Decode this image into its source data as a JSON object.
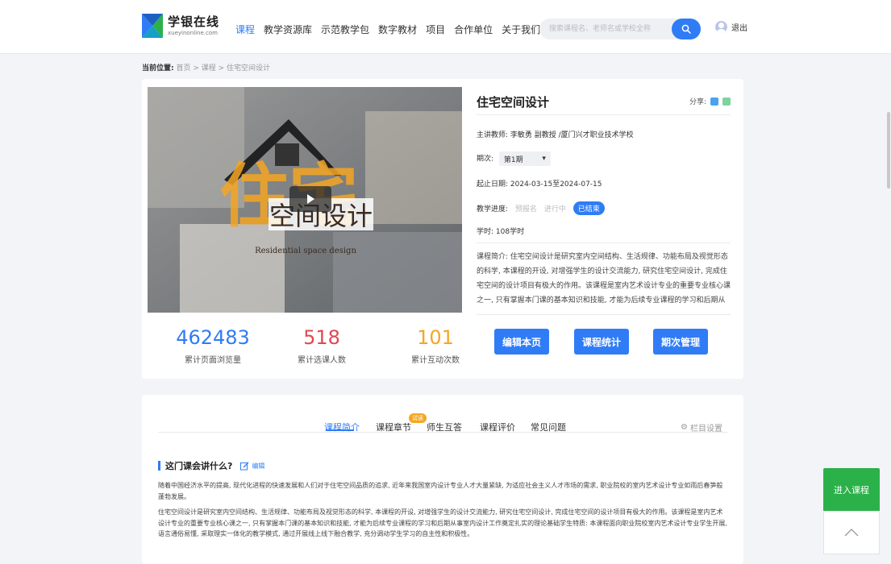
{
  "header": {
    "logo_cn": "学银在线",
    "logo_en": "xueyinonline.com",
    "nav": [
      {
        "label": "课程",
        "active": true
      },
      {
        "label": "教学资源库",
        "active": false
      },
      {
        "label": "示范教学包",
        "active": false
      },
      {
        "label": "数字教材",
        "active": false
      },
      {
        "label": "项目",
        "active": false
      },
      {
        "label": "合作单位",
        "active": false
      },
      {
        "label": "关于我们",
        "active": false
      }
    ],
    "search_placeholder": "搜索课程名、老师名或学校全称",
    "logout": "退出"
  },
  "breadcrumb": {
    "label": "当前位置:",
    "path": "首页 > 课程 > 住宅空间设计"
  },
  "course": {
    "cover_title": "空间设计",
    "cover_big_char": "住宅",
    "cover_en": "Residential space design",
    "title": "住宅空间设计",
    "share_label": "分享:",
    "teacher": "主讲教师: 李敏勇 副教授 /厦门兴才职业技术学校",
    "term_label": "期次:",
    "term_value": "第1期",
    "dates": "起止日期: 2024-03-15至2024-07-15",
    "progress_label": "教学进度:",
    "progress_states": [
      "预报名",
      "进行中",
      "已结束"
    ],
    "progress_active": "已结束",
    "hours": "学时: 108学时",
    "intro": "课程简介: 住宅空间设计是研究室内空间结构、生活规律、功能布局及视觉形态的科学, 本课程的开设, 对增强学生的设计交流能力, 研究住宅空间设计, 完成住宅空间的设计项目有极大的作用。该课程是室内艺术设计专业的重要专业核心课之一, 只有掌握本门课的基本知识和技能, 才能为后续专业课程的学习和后期从事室内设计工作奠定...",
    "buttons": {
      "edit": "编辑本页",
      "stats": "课程统计",
      "terms": "期次管理"
    }
  },
  "stats": [
    {
      "value": "462483",
      "label": "累计页面浏览量",
      "color": "#2f7cf6"
    },
    {
      "value": "518",
      "label": "累计选课人数",
      "color": "#e0484f"
    },
    {
      "value": "101",
      "label": "累计互动次数",
      "color": "#f5a623"
    }
  ],
  "tabs": {
    "items": [
      "课程简介",
      "课程章节",
      "师生互答",
      "课程评价",
      "常见问题"
    ],
    "active": "课程简介",
    "badge": "试读",
    "column_settings": "栏目设置"
  },
  "section": {
    "title": "这门课会讲什么?",
    "edit": "编辑",
    "para1": "随着中国经济水平的提高, 现代化进程的快速发展和人们对于住宅空间品质的追求, 近年来我国室内设计专业人才大量紧缺, 为适应社会主义人才市场的需求, 职业院校的室内艺术设计专业如雨后春笋般蓬勃发展。",
    "para2": "住宅空间设计是研究室内空间结构、生活规律、功能布局及视觉形态的科学, 本课程的开设, 对增强学生的设计交流能力, 研究住宅空间设计, 完成住宅空间的设计项目有极大的作用。该课程是室内艺术设计专业的重要专业核心课之一, 只有掌握本门课的基本知识和技能, 才能为后续专业课程的学习和后期从事室内设计工作奠定扎实的理论基础学生特质: 本课程面向职业院校室内艺术设计专业学生开展, 语言通俗易懂, 采取理实一体化的教学模式, 通过开展线上线下融合教学, 充分调动学生学习的自主性和积极性。"
  },
  "float": {
    "enter": "进入课程"
  },
  "colors": {
    "accent": "#2f7cf6",
    "green": "#2bb14a",
    "red": "#e0484f",
    "orange": "#f5a623"
  }
}
